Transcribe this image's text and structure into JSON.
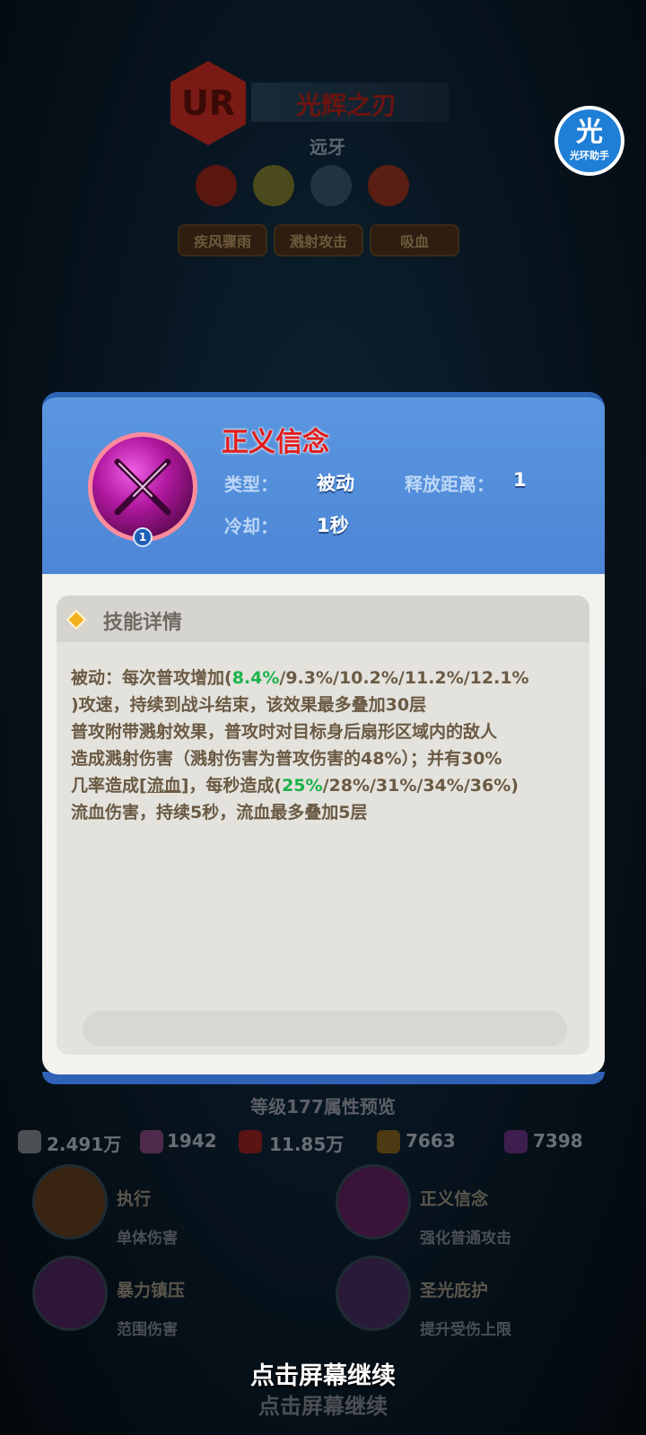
{
  "hero": {
    "rarity": "UR",
    "name": "光辉之刃",
    "class": "远牙",
    "tags": [
      "疾风骤雨",
      "溅射攻击",
      "吸血"
    ]
  },
  "assistant": {
    "glyph": "光",
    "label": "光环助手"
  },
  "skill": {
    "name": "正义信念",
    "level": "1",
    "type_label": "类型：",
    "type_value": "被动",
    "range_label": "释放距离：",
    "range_value": "1",
    "cooldown_label": "冷却：",
    "cooldown_value": "1秒",
    "detail_title": "技能详情",
    "desc": {
      "l1a": "被动：每次普攻增加(",
      "l1g": "8.4%",
      "l1b": "/9.3%/10.2%/11.2%/12.1%",
      "l2": ")攻速，持续到战斗结束，该效果最多叠加30层",
      "l3": "普攻附带溅射效果，普攻时对目标身后扇形区域内的敌人",
      "l4": "造成溅射伤害（溅射伤害为普攻伤害的48%）；并有30%",
      "l5a": "几率造成[",
      "l5u": "流血",
      "l5b": "]，每秒造成(",
      "l5g": "25%",
      "l5c": "/28%/31%/34%/36%)",
      "l6": "流血伤害，持续5秒，流血最多叠加5层"
    }
  },
  "preview": {
    "title": "等级177属性预览",
    "stats": [
      "2.491万",
      "1942",
      "11.85万",
      "7663",
      "7398"
    ],
    "skills": [
      {
        "name": "执行",
        "desc": "单体伤害"
      },
      {
        "name": "正义信念",
        "desc": "强化普通攻击"
      },
      {
        "name": "暴力镇压",
        "desc": "范围伤害"
      },
      {
        "name": "圣光庇护",
        "desc": "提升受伤上限"
      }
    ]
  },
  "continue_text": "点击屏幕继续",
  "colors": {
    "card_blue": "#4c86d6",
    "skill_name_red": "#e11d1d",
    "highlight_green": "#1bb34a"
  }
}
